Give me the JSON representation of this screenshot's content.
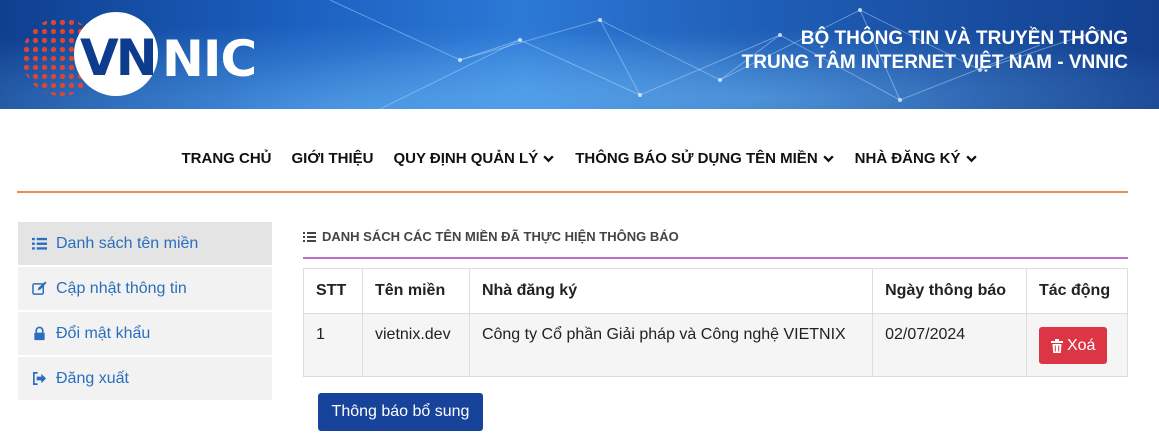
{
  "header": {
    "logo_vn": "VN",
    "logo_nic": "NIC",
    "org_line1": "BỘ THÔNG TIN VÀ TRUYỀN THÔNG",
    "org_line2": "TRUNG TÂM INTERNET VIỆT NAM - VNNIC"
  },
  "nav": {
    "items": [
      {
        "label": "TRANG CHỦ",
        "dropdown": false
      },
      {
        "label": "GIỚI THIỆU",
        "dropdown": false
      },
      {
        "label": "QUY ĐỊNH QUẢN LÝ",
        "dropdown": true
      },
      {
        "label": "THÔNG BÁO SỬ DỤNG TÊN MIỀN",
        "dropdown": true
      },
      {
        "label": "NHÀ ĐĂNG KÝ",
        "dropdown": true
      }
    ],
    "accent_color": "#f08a50"
  },
  "sidebar": {
    "items": [
      {
        "label": "Danh sách tên miền",
        "icon": "list-icon",
        "active": true
      },
      {
        "label": "Cập nhật thông tin",
        "icon": "edit-icon",
        "active": false
      },
      {
        "label": "Đổi mật khẩu",
        "icon": "lock-icon",
        "active": false
      },
      {
        "label": "Đăng xuất",
        "icon": "logout-icon",
        "active": false
      }
    ],
    "link_color": "#2a6ebd"
  },
  "main": {
    "title": "DANH SÁCH CÁC TÊN MIỀN ĐÃ THỰC HIỆN THÔNG BÁO",
    "table": {
      "headers": [
        "STT",
        "Tên miền",
        "Nhà đăng ký",
        "Ngày thông báo",
        "Tác động"
      ],
      "rows": [
        {
          "stt": "1",
          "domain": "vietnix.dev",
          "registrar": "Công ty Cổ phần Giải pháp và Công nghệ VIETNIX",
          "date": "02/07/2024",
          "action_label": "Xoá"
        }
      ]
    },
    "add_button_label": "Thông báo bổ sung",
    "delete_color": "#dc3545",
    "primary_color": "#17449a"
  }
}
